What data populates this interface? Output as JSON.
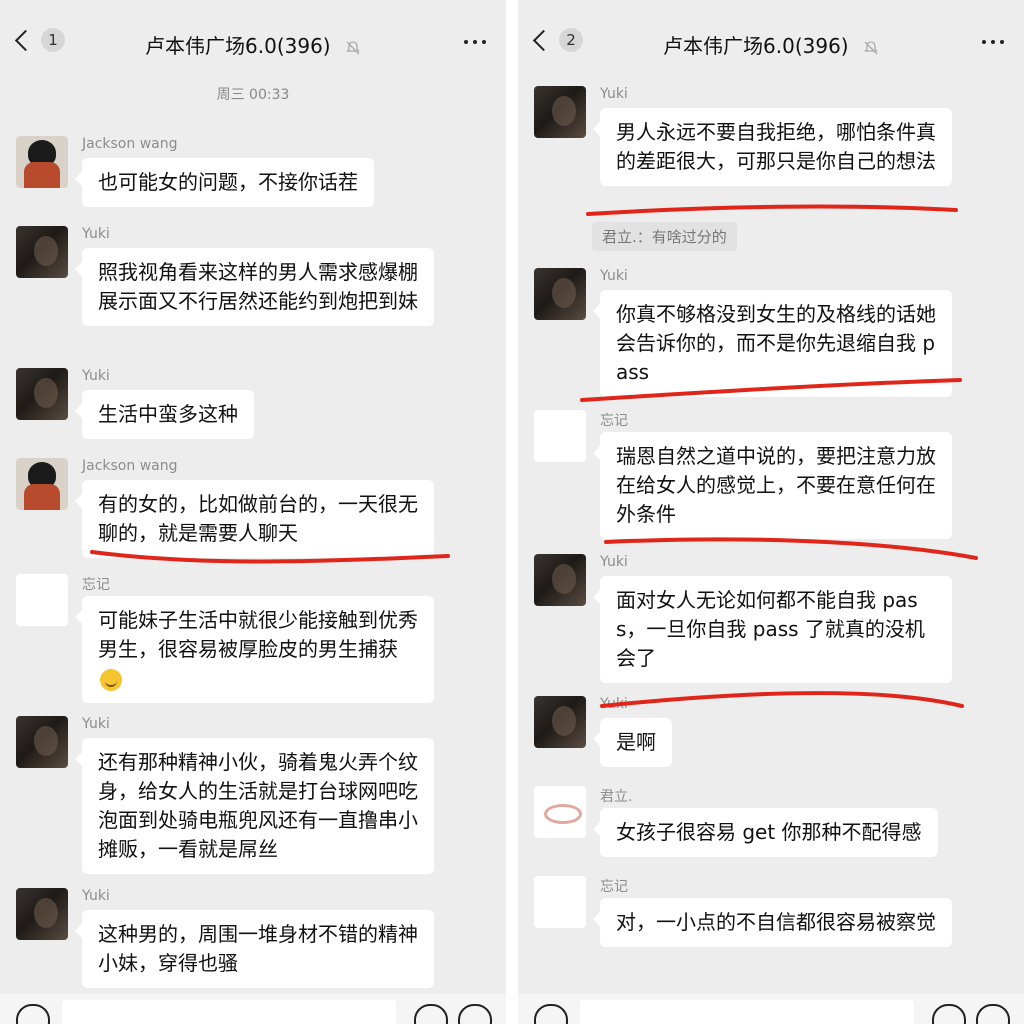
{
  "panels": [
    {
      "back_badge": "1",
      "title": "卢本伟广场6.0(396)",
      "timestamp": "周三 00:33",
      "messages": [
        {
          "sender": "Jackson wang",
          "text": "也可能女的问题，不接你话茬"
        },
        {
          "sender": "Yuki",
          "text": "照我视角看来这样的男人需求感爆棚展示面又不行居然还能约到炮把到妹"
        },
        {
          "sender": "Yuki",
          "text": "生活中蛮多这种"
        },
        {
          "sender": "Jackson wang",
          "text": "有的女的，比如做前台的，一天很无聊的，就是需要人聊天"
        },
        {
          "sender": "忘记",
          "text": "可能妹子生活中就很少能接触到优秀男生，很容易被厚脸皮的男生捕获"
        },
        {
          "sender": "Yuki",
          "text": "还有那种精神小伙，骑着鬼火弄个纹身，给女人的生活就是打台球网吧吃泡面到处骑电瓶兜风还有一直撸串小摊贩，一看就是屌丝"
        },
        {
          "sender": "Yuki",
          "text": "这种男的，周围一堆身材不错的精神小妹，穿得也骚"
        }
      ]
    },
    {
      "back_badge": "2",
      "title": "卢本伟广场6.0(396)",
      "quote": "君立.：有啥过分的",
      "messages": [
        {
          "sender": "Yuki",
          "text": "男人永远不要自我拒绝，哪怕条件真的差距很大，可那只是你自己的想法"
        },
        {
          "sender": "Yuki",
          "text": "你真不够格没到女生的及格线的话她会告诉你的，而不是你先退缩自我 pass"
        },
        {
          "sender": "忘记",
          "text": "瑞恩自然之道中说的，要把注意力放在给女人的感觉上，不要在意任何在外条件"
        },
        {
          "sender": "Yuki",
          "text": "面对女人无论如何都不能自我 pass，一旦你自我 pass 了就真的没机会了"
        },
        {
          "sender": "Yuki",
          "text": "是啊"
        },
        {
          "sender": "君立.",
          "text": "女孩子很容易 get 你那种不配得感"
        },
        {
          "sender": "忘记",
          "text": "对，一小点的不自信都很容易被察觉"
        }
      ]
    }
  ],
  "colors": {
    "underline": "#e0261b",
    "bubble": "#ffffff",
    "background": "#ededed"
  }
}
